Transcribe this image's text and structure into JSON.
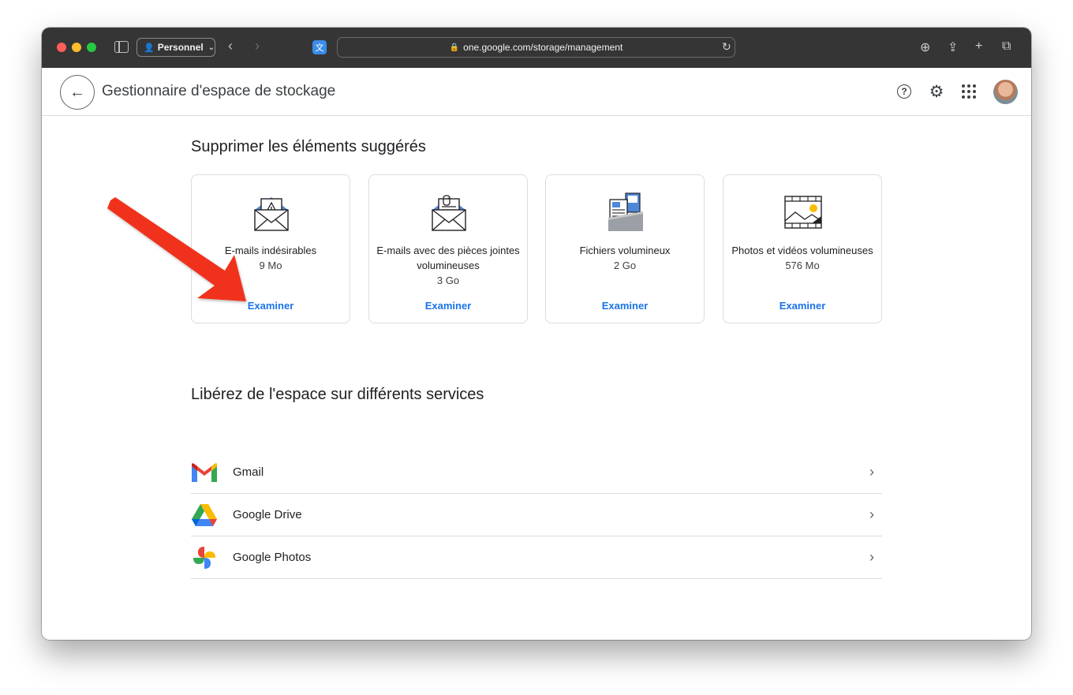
{
  "browser": {
    "profile_label": "Personnel",
    "url": "one.google.com/storage/management"
  },
  "appbar": {
    "title": "Gestionnaire d'espace de stockage"
  },
  "suggested": {
    "heading": "Supprimer les éléments suggérés",
    "cards": [
      {
        "title": "E-mails indésirables",
        "size": "9 Mo",
        "action": "Examiner",
        "icon": "spam-mail-icon"
      },
      {
        "title": "E-mails avec des pièces jointes volumineuses",
        "size": "3 Go",
        "action": "Examiner",
        "icon": "attachment-mail-icon"
      },
      {
        "title": "Fichiers volumineux",
        "size": "2 Go",
        "action": "Examiner",
        "icon": "large-files-icon"
      },
      {
        "title": "Photos et vidéos volumineuses",
        "size": "576 Mo",
        "action": "Examiner",
        "icon": "photo-video-icon"
      }
    ]
  },
  "services": {
    "heading": "Libérez de l'espace sur différents services",
    "items": [
      {
        "label": "Gmail",
        "icon": "gmail-icon"
      },
      {
        "label": "Google Drive",
        "icon": "google-drive-icon"
      },
      {
        "label": "Google Photos",
        "icon": "google-photos-icon"
      }
    ]
  },
  "colors": {
    "accent": "#1a73e8",
    "annotation_arrow": "#f0321e",
    "titlebar": "#353535"
  }
}
